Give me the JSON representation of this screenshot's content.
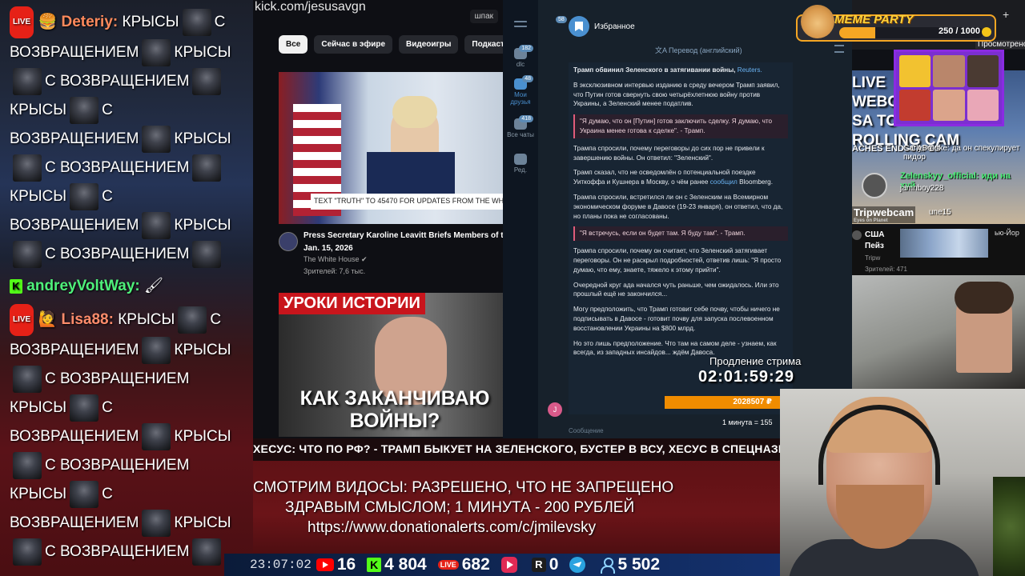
{
  "chat": {
    "messages": [
      {
        "badge": "LIVE",
        "nick": "Deteriy:",
        "lines": [
          [
            "КРЫСЫ",
            "С"
          ],
          [
            "ВОЗВРАЩЕНИЕМ",
            "КРЫСЫ"
          ],
          [
            "С ВОЗВРАЩЕНИЕМ"
          ],
          [
            "КРЫСЫ",
            "С"
          ],
          [
            "ВОЗВРАЩЕНИЕМ",
            "КРЫСЫ"
          ],
          [
            "С ВОЗВРАЩЕНИЕМ"
          ],
          [
            "КРЫСЫ",
            "С"
          ],
          [
            "ВОЗВРАЩЕНИЕМ",
            "КРЫСЫ"
          ],
          [
            "С ВОЗВРАЩЕНИЕМ"
          ]
        ]
      },
      {
        "badge": "K",
        "nick": "andreyVoltWay:",
        "text": "🖌"
      },
      {
        "badge": "LIVE",
        "nick": "Lisa88:",
        "lines": [
          [
            "КРЫСЫ",
            "С"
          ],
          [
            "ВОЗВРАЩЕНИЕМ",
            "КРЫСЫ"
          ],
          [
            "С ВОЗВРАЩЕНИЕМ"
          ],
          [
            "КРЫСЫ",
            "С"
          ],
          [
            "ВОЗВРАЩЕНИЕМ",
            "КРЫСЫ"
          ],
          [
            "С ВОЗВРАЩЕНИЕМ"
          ],
          [
            "КРЫСЫ",
            "С"
          ],
          [
            "ВОЗВРАЩЕНИЕМ",
            "КРЫСЫ"
          ],
          [
            "С ВОЗВРАЩЕНИЕМ"
          ]
        ]
      }
    ]
  },
  "browser": {
    "url": "kick.com/jesusavgn",
    "chips": [
      "Все",
      "Сейчас в эфире",
      "Видеоигры",
      "Подкасты",
      "М"
    ],
    "spoiler": "шпак",
    "video1": {
      "ticker": "TEXT \"TRUTH\" TO 45470 FOR UPDATES FROM THE WHITE H",
      "title": "Press Secretary Karoline Leavitt Briefs Members of th",
      "date": "Jan. 15, 2026",
      "channel": "The White House",
      "views": "Зрителей: 7,6 тыс."
    },
    "video2": {
      "top": "УРОКИ ИСТОРИИ",
      "bottom": "КАК ЗАКАНЧИВАЮ ВОЙНЫ?"
    }
  },
  "telegram": {
    "sidebar": [
      {
        "label": "dlc",
        "count": "182"
      },
      {
        "label": "Мои друзья",
        "count": "48"
      },
      {
        "label": "Все чаты",
        "count": "418"
      },
      {
        "label": "Ред.",
        "count": ""
      }
    ],
    "header_badge": "58",
    "chat_name": "Избранное",
    "translate": "Перевод (английский)",
    "message": {
      "headline": "Трамп обвинил Зеленского в затягивании войны,",
      "source": "Reuters.",
      "p1": "В эксклюзивном интервью изданию в среду вечером Трамп заявил, что Путин готов свернуть свою четырёхлетнюю войну против Украины, а Зеленский менее податлив.",
      "q1": "\"Я думаю, что он [Путин] готов заключить сделку. Я думаю, что Украина менее готова к сделке\". - Трамп.",
      "p2": "Трампа спросили, почему переговоры до сих пор не привели к завершению войны. Он ответил: \"Зеленский\".",
      "p3a": "Трамп сказал, что не осведомлён о потенциальной поездке Уиткоффа и Кушнера в Москву, о чём ранее",
      "p3link": "сообщил",
      "p3b": "Bloomberg.",
      "p4": "Трампа спросили, встретился ли он с Зеленским на Всемирном экономическом форуме в Давосе (19-23 января), он ответил, что да, но планы пока не согласованы.",
      "q2": "\"Я встречусь, если он будет там. Я буду там\". - Трамп.",
      "p5": "Трампа спросили, почему он считает, что Зеленский затягивает переговоры. Он не раскрыл подробностей, ответив лишь: \"Я просто думаю, что ему, знаете, тяжело к этому прийти\".",
      "p6": "Очередной круг ада начался чуть раньше, чем ожидалось. Или это прошлый ещё не закончился...",
      "p7": "Могу предположить, что Трамп готовит себе почву, чтобы ничего не подписывать в Давосе - готовит почву для запуска послевоенном восстановлении Украины на $800 млрд.",
      "p8": "Но это лишь предположение. Что там на самом деле - узнаем, как всегда, из западных инсайдов... ждём Давоса."
    },
    "user_initial": "J",
    "input_placeholder": "Сообщение"
  },
  "meme_party": {
    "title": "MEME PARTY",
    "value": "250 / 1000",
    "progress": 0.25
  },
  "right_top_tag": "Просмотрено",
  "livecam": {
    "big": "LIVE\nWEBCO\nSA TO\nROLLING CAM",
    "sub": "ACHES  ENDSCAPES",
    "chat1": "CarlyBrooke: да он спекулирует",
    "chat1b": "пидор",
    "chat2": "Zelenskyy_official: иди на хуй",
    "chat3": "jamnboy228",
    "chat4": "une15",
    "trip": "Tripwebcam",
    "trip_sub": "Eyes on Planet"
  },
  "news": {
    "t1": "США",
    "t2": "Пейз",
    "ny": "ью-Йор",
    "src": "Tripw",
    "views": "Зрителей: 471"
  },
  "extend": {
    "label": "Продление стрима",
    "time": "02:01:59:29",
    "amount": "2028507 ₽",
    "rate": "1 минута = 155"
  },
  "lower_third": {
    "ticker": "ХЕСУС: ЧТО ПО РФ? - ТРАМП БЫКУЕТ НА ЗЕЛЕНСКОГО, БУСТЕР В ВСУ, ХЕСУС В СПЕЦНАЗЕ ПУТИНА,",
    "rules1": "СМОТРИМ ВИДОСЫ: РАЗРЕШЕНО, ЧТО НЕ ЗАПРЕЩЕНО",
    "rules2": "ЗДРАВЫМ СМЫСЛОМ; 1 МИНУТА - 200 РУБЛЕЙ",
    "rules3": "https://www.donationalerts.com/c/jmilevsky"
  },
  "stats": {
    "clock": "23:07:02",
    "youtube": "16",
    "kick": "4 804",
    "vklive": "682",
    "rutube": "0",
    "rumble": "0",
    "telegram": "",
    "viewers": "5 502"
  },
  "colors": {
    "kick": "#53fc18",
    "youtube": "#ff0000",
    "telegram_bg": "#17212b",
    "accent_orange": "#f08c00",
    "meme_yellow": "#ffd23a"
  }
}
